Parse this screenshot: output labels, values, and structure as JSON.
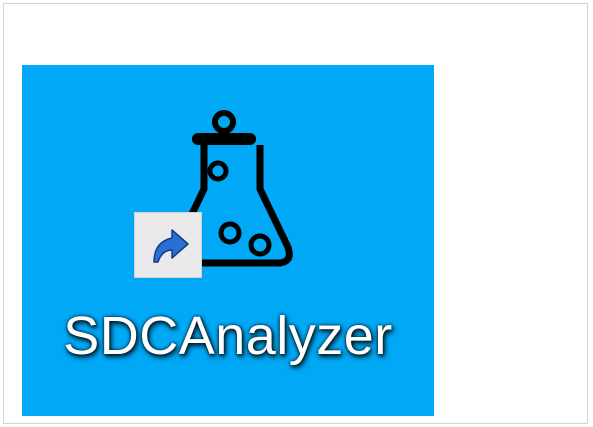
{
  "desktop": {
    "background": "#ffffff",
    "selection_color": "#00a8f5",
    "icons": [
      {
        "label": "SDCAnalyzer",
        "icon": "flask-icon",
        "shortcut_overlay": "shortcut-arrow-icon",
        "selected": true
      }
    ]
  }
}
